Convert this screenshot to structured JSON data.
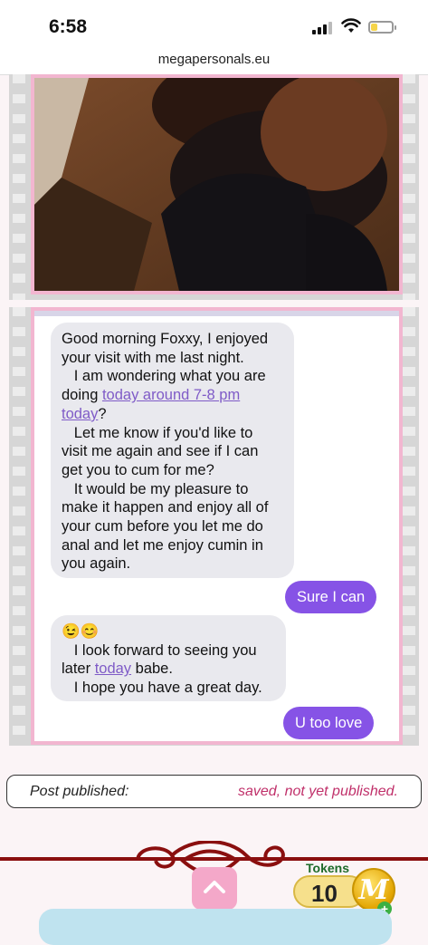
{
  "status": {
    "time": "6:58"
  },
  "browser": {
    "url": "megapersonals.eu"
  },
  "messages": [
    {
      "dir": "in",
      "parts": [
        {
          "t": "Good morning Foxxy, I enjoyed\nyour visit with me last night.\n   I am wondering what you are\ndoing "
        },
        {
          "t": "today around 7-8 pm\ntoday",
          "link": true
        },
        {
          "t": "?\n   Let me know if you'd like to\nvisit me again and see if I can\nget you to cum for me?\n   It would be my pleasure to\nmake it happen and enjoy all of\nyour cum before you let me do\nanal and let me enjoy cumin in\nyou again."
        }
      ]
    },
    {
      "dir": "out",
      "text": "Sure I can"
    },
    {
      "dir": "in",
      "parts": [
        {
          "t": "😉😊\n   I look forward to seeing you\nlater "
        },
        {
          "t": "today",
          "link": true
        },
        {
          "t": " babe.\n   I hope you have a great day."
        }
      ]
    },
    {
      "dir": "out",
      "text": "U too love"
    }
  ],
  "post": {
    "label": "Post published:",
    "status": "saved, not yet published."
  },
  "tokens": {
    "label": "Tokens",
    "value": "10",
    "coin_letter": "M"
  },
  "colors": {
    "accent": "#8653e6",
    "frame": "#f2b6d0",
    "status": "#c0306a"
  }
}
